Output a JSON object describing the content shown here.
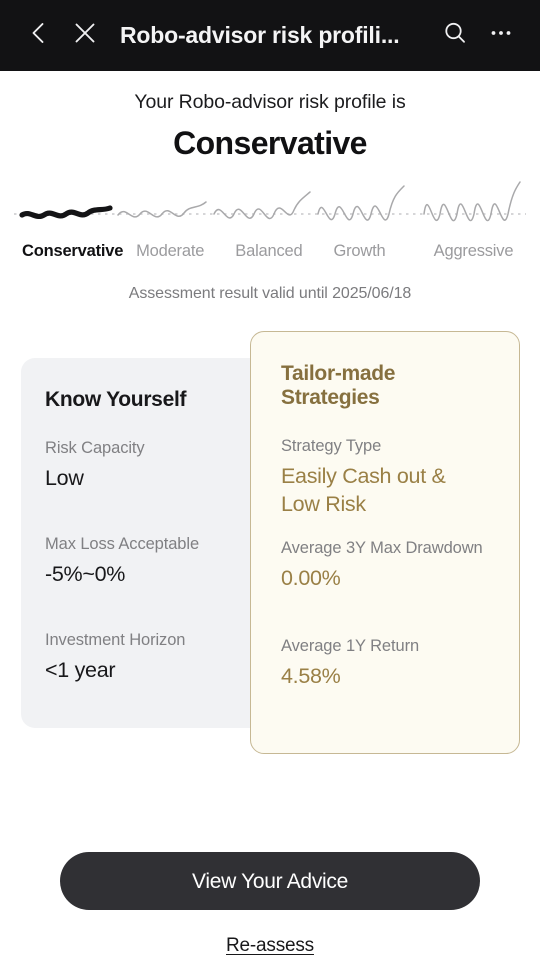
{
  "header": {
    "back_icon": "chevron-left-icon",
    "close_icon": "close-icon",
    "title": "Robo-advisor risk profili...",
    "search_icon": "search-icon",
    "more_icon": "more-options-icon"
  },
  "intro": {
    "subtitle": "Your Robo-advisor risk profile is",
    "profile": "Conservative"
  },
  "scale": {
    "levels": [
      {
        "label": "Conservative",
        "active": true
      },
      {
        "label": "Moderate",
        "active": false
      },
      {
        "label": "Balanced",
        "active": false
      },
      {
        "label": "Growth",
        "active": false
      },
      {
        "label": "Aggressive",
        "active": false
      }
    ],
    "active_color": "#111113",
    "inactive_color": "#9b9b9e",
    "wave_active_color": "#141416",
    "wave_inactive_color": "#a9a9ab",
    "baseline_color": "#c9c9cc"
  },
  "validity": {
    "note": "Assessment result valid until 2025/06/18"
  },
  "cards": {
    "left": {
      "title": "Know Yourself",
      "background": "#f1f2f4",
      "fields": [
        {
          "label": "Risk Capacity",
          "value": "Low"
        },
        {
          "label": "Max Loss Acceptable",
          "value": "-5%~0%"
        },
        {
          "label": "Investment Horizon",
          "value": "<1 year"
        }
      ]
    },
    "right": {
      "title": "Tailor-made Strategies",
      "background": "#fdfbf2",
      "border_color": "#c6b894",
      "title_color": "#86703f",
      "value_color": "#9a8046",
      "fields": [
        {
          "label": "Strategy Type",
          "value": "Easily Cash out & Low Risk"
        },
        {
          "label": "Average 3Y Max Drawdown",
          "value": "0.00%"
        },
        {
          "label": "Average 1Y Return",
          "value": "4.58%"
        }
      ]
    }
  },
  "footer": {
    "primary_label": "View Your Advice",
    "primary_color": "#303034",
    "link_label": "Re-assess"
  }
}
